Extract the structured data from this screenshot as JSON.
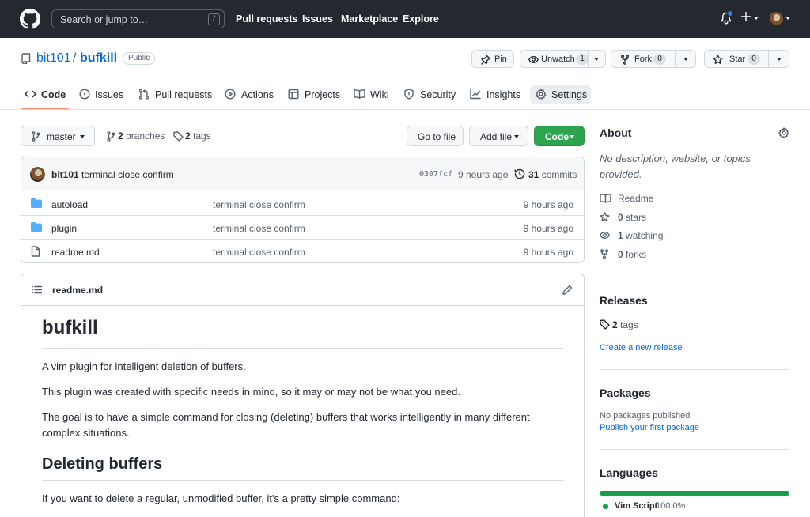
{
  "header": {
    "search_placeholder": "Search or jump to…",
    "search_shortcut": "/",
    "nav": [
      "Pull requests",
      "Issues",
      "Marketplace",
      "Explore"
    ]
  },
  "repo": {
    "owner": "bit101",
    "separator": "/",
    "name": "bufkill",
    "visibility": "Public",
    "actions": {
      "pin_label": "Pin",
      "unwatch_label": "Unwatch",
      "unwatch_count": "1",
      "fork_label": "Fork",
      "fork_count": "0",
      "star_label": "Star",
      "star_count": "0"
    }
  },
  "tabs": [
    {
      "label": "Code",
      "icon": "code-icon",
      "active": true
    },
    {
      "label": "Issues",
      "icon": "issue-icon"
    },
    {
      "label": "Pull requests",
      "icon": "pull-request-icon"
    },
    {
      "label": "Actions",
      "icon": "play-icon"
    },
    {
      "label": "Projects",
      "icon": "table-icon"
    },
    {
      "label": "Wiki",
      "icon": "book-icon"
    },
    {
      "label": "Security",
      "icon": "shield-icon"
    },
    {
      "label": "Insights",
      "icon": "graph-icon"
    },
    {
      "label": "Settings",
      "icon": "gear-icon",
      "highlighted": true
    }
  ],
  "toolbar": {
    "branch": "master",
    "branches_count": "2",
    "branches_label": "branches",
    "tags_count": "2",
    "tags_label": "tags",
    "goto_file": "Go to file",
    "add_file": "Add file",
    "code": "Code"
  },
  "commit": {
    "author": "bit101",
    "message": "terminal close confirm",
    "sha": "0307fcf",
    "time": "9 hours ago",
    "count": "31",
    "count_label": "commits"
  },
  "files": [
    {
      "type": "folder",
      "name": "autoload",
      "message": "terminal close confirm",
      "time": "9 hours ago"
    },
    {
      "type": "folder",
      "name": "plugin",
      "message": "terminal close confirm",
      "time": "9 hours ago"
    },
    {
      "type": "file",
      "name": "readme.md",
      "message": "terminal close confirm",
      "time": "9 hours ago"
    }
  ],
  "readme": {
    "filename": "readme.md",
    "h1": "bufkill",
    "p1": "A vim plugin for intelligent deletion of buffers.",
    "p2": "This plugin was created with specific needs in mind, so it may or may not be what you need.",
    "p3": "The goal is to have a simple command for closing (deleting) buffers that works intelligently in many different complex situations.",
    "h2": "Deleting buffers",
    "p4": "If you want to delete a regular, unmodified buffer, it's a pretty simple command:"
  },
  "sidebar": {
    "about_title": "About",
    "about_desc": "No description, website, or topics provided.",
    "readme_label": "Readme",
    "stars_count": "0",
    "stars_label": "stars",
    "watching_count": "1",
    "watching_label": "watching",
    "forks_count": "0",
    "forks_label": "forks",
    "releases_title": "Releases",
    "release_tags_count": "2",
    "release_tags_label": "tags",
    "create_release": "Create a new release",
    "packages_title": "Packages",
    "packages_none": "No packages published",
    "publish_package": "Publish your first package",
    "languages_title": "Languages",
    "language_name": "Vim Script",
    "language_pct": "100.0%",
    "language_color": "#199f4b"
  },
  "colors": {
    "header_bg": "#24292f",
    "link": "#0969da",
    "green_button": "#2da44e",
    "tab_underline": "#fd8c73",
    "folder": "#54aeff"
  }
}
